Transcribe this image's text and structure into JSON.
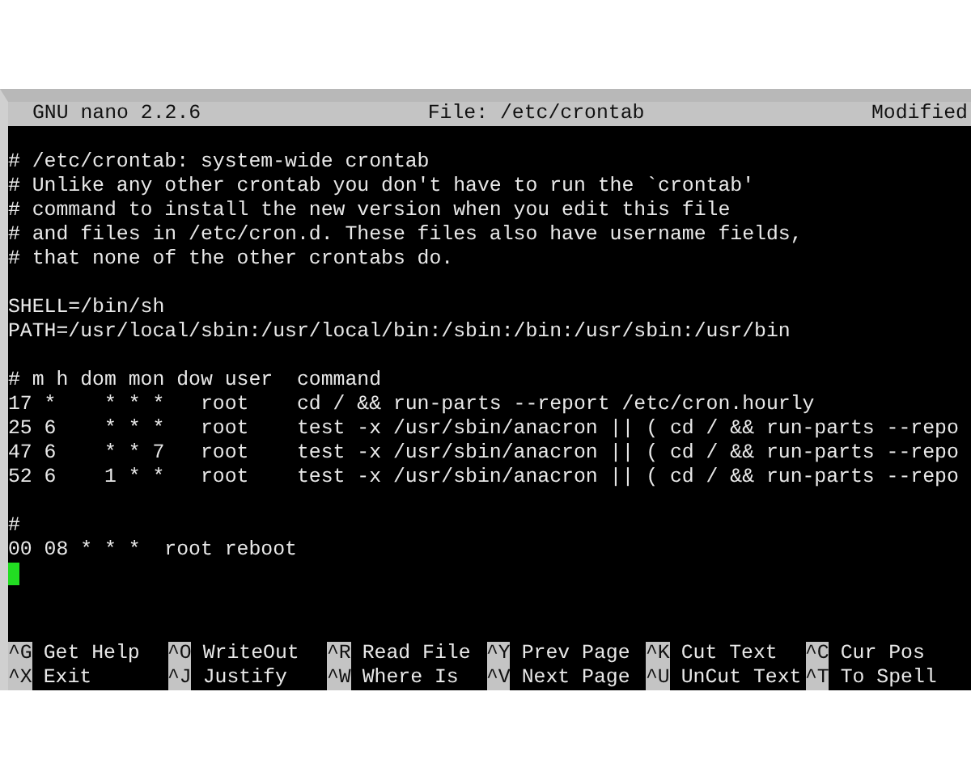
{
  "title_bar": {
    "app": "GNU nano 2.2.6",
    "file": "File: /etc/crontab",
    "status": "Modified"
  },
  "lines": [
    {
      "kind": "blank"
    },
    {
      "kind": "text",
      "text": "# /etc/crontab: system-wide crontab"
    },
    {
      "kind": "text",
      "text": "# Unlike any other crontab you don't have to run the `crontab'"
    },
    {
      "kind": "text",
      "text": "# command to install the new version when you edit this file"
    },
    {
      "kind": "text",
      "text": "# and files in /etc/cron.d. These files also have username fields,"
    },
    {
      "kind": "text",
      "text": "# that none of the other crontabs do."
    },
    {
      "kind": "blank"
    },
    {
      "kind": "text",
      "text": "SHELL=/bin/sh"
    },
    {
      "kind": "text",
      "text": "PATH=/usr/local/sbin:/usr/local/bin:/sbin:/bin:/usr/sbin:/usr/bin"
    },
    {
      "kind": "blank"
    },
    {
      "kind": "text",
      "text": "# m h dom mon dow user  command"
    },
    {
      "kind": "text",
      "text": "17 *    * * *   root    cd / && run-parts --report /etc/cron.hourly"
    },
    {
      "kind": "text",
      "text": "25 6    * * *   root    test -x /usr/sbin/anacron || ( cd / && run-parts --repo"
    },
    {
      "kind": "text",
      "text": "47 6    * * 7   root    test -x /usr/sbin/anacron || ( cd / && run-parts --repo"
    },
    {
      "kind": "text",
      "text": "52 6    1 * *   root    test -x /usr/sbin/anacron || ( cd / && run-parts --repo"
    },
    {
      "kind": "blank"
    },
    {
      "kind": "text",
      "text": "#"
    },
    {
      "kind": "text",
      "text": "00 08 * * *  root reboot"
    },
    {
      "kind": "cursor"
    }
  ],
  "shortcuts": [
    [
      {
        "key": "^G",
        "label": "Get Help"
      },
      {
        "key": "^O",
        "label": "WriteOut"
      },
      {
        "key": "^R",
        "label": "Read File"
      },
      {
        "key": "^Y",
        "label": "Prev Page"
      },
      {
        "key": "^K",
        "label": "Cut Text"
      },
      {
        "key": "^C",
        "label": "Cur Pos"
      }
    ],
    [
      {
        "key": "^X",
        "label": "Exit"
      },
      {
        "key": "^J",
        "label": "Justify"
      },
      {
        "key": "^W",
        "label": "Where Is"
      },
      {
        "key": "^V",
        "label": "Next Page"
      },
      {
        "key": "^U",
        "label": "UnCut Text"
      },
      {
        "key": "^T",
        "label": "To Spell"
      }
    ]
  ]
}
